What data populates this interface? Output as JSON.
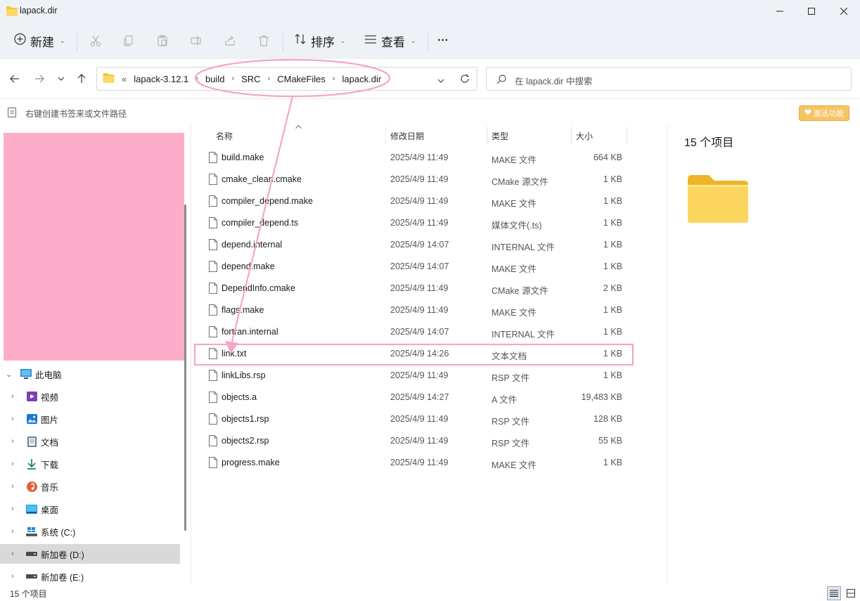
{
  "window": {
    "title": "lapack.dir"
  },
  "toolbar": {
    "new_label": "新建",
    "sort_label": "排序",
    "view_label": "查看",
    "more_label": "···"
  },
  "address": {
    "overflow": "«",
    "crumbs": [
      "lapack-3.12.1",
      "build",
      "SRC",
      "CMakeFiles",
      "lapack.dir"
    ]
  },
  "search": {
    "placeholder": "在 lapack.dir 中搜索"
  },
  "bookmark": {
    "hint": "右键创建书签来或文件路径",
    "activate_label": "激活功能"
  },
  "sidebar": {
    "items": [
      {
        "label": "此电脑",
        "icon": "pc-icon",
        "level": 0
      },
      {
        "label": "视频",
        "icon": "video-icon",
        "level": 1
      },
      {
        "label": "图片",
        "icon": "pictures-icon",
        "level": 1
      },
      {
        "label": "文档",
        "icon": "documents-icon",
        "level": 1
      },
      {
        "label": "下载",
        "icon": "download-icon",
        "level": 1
      },
      {
        "label": "音乐",
        "icon": "music-icon",
        "level": 1
      },
      {
        "label": "桌面",
        "icon": "desktop-icon",
        "level": 1
      },
      {
        "label": "系统 (C:)",
        "icon": "windows-drive-icon",
        "level": 1
      },
      {
        "label": "新加卷 (D:)",
        "icon": "drive-icon",
        "level": 1,
        "selected": true
      },
      {
        "label": "新加卷 (E:)",
        "icon": "drive-icon",
        "level": 1
      }
    ]
  },
  "columns": {
    "name": "名称",
    "date": "修改日期",
    "type": "类型",
    "size": "大小"
  },
  "files": [
    {
      "name": "build.make",
      "date": "2025/4/9 11:49",
      "type": "MAKE 文件",
      "size": "664 KB"
    },
    {
      "name": "cmake_clean.cmake",
      "date": "2025/4/9 11:49",
      "type": "CMake 源文件",
      "size": "1 KB"
    },
    {
      "name": "compiler_depend.make",
      "date": "2025/4/9 11:49",
      "type": "MAKE 文件",
      "size": "1 KB"
    },
    {
      "name": "compiler_depend.ts",
      "date": "2025/4/9 11:49",
      "type": "媒体文件(.ts)",
      "size": "1 KB"
    },
    {
      "name": "depend.internal",
      "date": "2025/4/9 14:07",
      "type": "INTERNAL 文件",
      "size": "1 KB"
    },
    {
      "name": "depend.make",
      "date": "2025/4/9 14:07",
      "type": "MAKE 文件",
      "size": "1 KB"
    },
    {
      "name": "DependInfo.cmake",
      "date": "2025/4/9 11:49",
      "type": "CMake 源文件",
      "size": "2 KB"
    },
    {
      "name": "flags.make",
      "date": "2025/4/9 11:49",
      "type": "MAKE 文件",
      "size": "1 KB"
    },
    {
      "name": "fortran.internal",
      "date": "2025/4/9 14:07",
      "type": "INTERNAL 文件",
      "size": "1 KB"
    },
    {
      "name": "link.txt",
      "date": "2025/4/9 14:26",
      "type": "文本文档",
      "size": "1 KB",
      "highlighted": true
    },
    {
      "name": "linkLibs.rsp",
      "date": "2025/4/9 11:49",
      "type": "RSP 文件",
      "size": "1 KB"
    },
    {
      "name": "objects.a",
      "date": "2025/4/9 14:27",
      "type": "A 文件",
      "size": "19,483 KB"
    },
    {
      "name": "objects1.rsp",
      "date": "2025/4/9 11:49",
      "type": "RSP 文件",
      "size": "128 KB"
    },
    {
      "name": "objects2.rsp",
      "date": "2025/4/9 11:49",
      "type": "RSP 文件",
      "size": "55 KB"
    },
    {
      "name": "progress.make",
      "date": "2025/4/9 11:49",
      "type": "MAKE 文件",
      "size": "1 KB"
    }
  ],
  "preview": {
    "count_label": "15 个项目"
  },
  "status": {
    "count_label": "15 个项目"
  },
  "colors": {
    "annotation": "#f4a6c8",
    "folder": "#f8c537",
    "redaction": "#fdadc9",
    "selection": "#d9d9d9"
  }
}
